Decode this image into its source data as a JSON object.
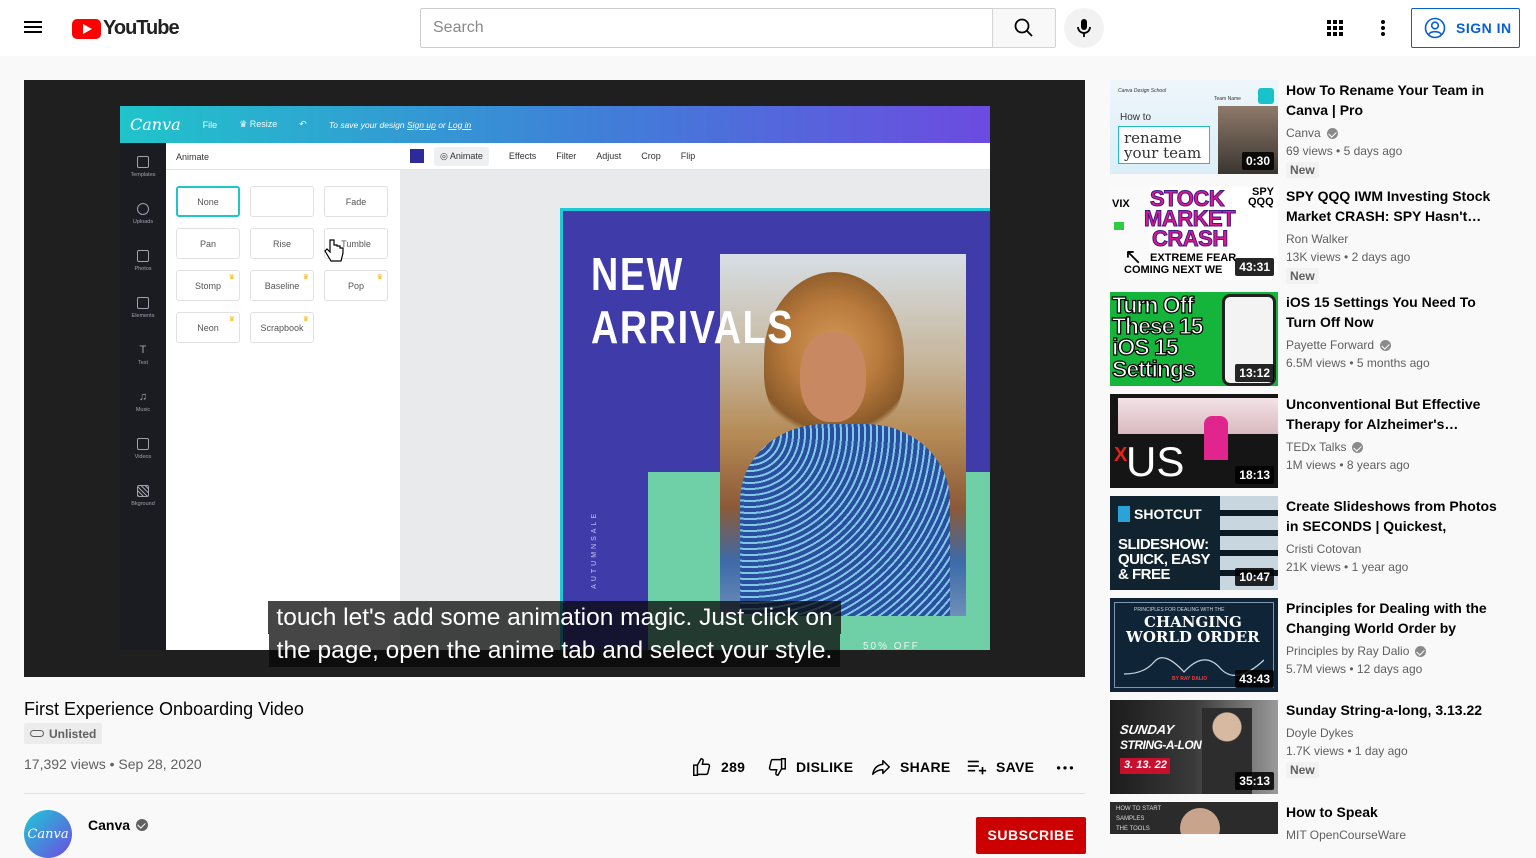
{
  "header": {
    "logo_text": "YouTube",
    "search_placeholder": "Search",
    "signin_label": "SIGN IN"
  },
  "player": {
    "canva_brand": "Canva",
    "canva_topbar": {
      "file": "File",
      "resize": "Resize",
      "note_prefix": "To save your design",
      "signup": "Sign up",
      "or": "or",
      "login": "Log in"
    },
    "left_tools": [
      "Templates",
      "Uploads",
      "Photos",
      "Elements",
      "Text",
      "Music",
      "Videos",
      "Bkground"
    ],
    "panel_title": "Animate",
    "animations": [
      "None",
      "",
      "Fade",
      "Pan",
      "Rise",
      "Tumble",
      "Stomp",
      "Baseline",
      "Pop",
      "Neon",
      "Scrapbook"
    ],
    "context_bar": [
      "Animate",
      "Effects",
      "Filter",
      "Adjust",
      "Crop",
      "Flip"
    ],
    "design_headline_1": "NEW",
    "design_headline_2": "ARRIVALS",
    "design_vertical_text": "AUTUMNSALE",
    "design_bottom_text": "50% OFF",
    "caption_line_1": "touch let's add some animation magic. Just click on",
    "caption_line_2": "the page, open the anime tab and select your style."
  },
  "video": {
    "title": "First Experience Onboarding Video",
    "visibility": "Unlisted",
    "views": "17,392 views",
    "date": "Sep 28, 2020",
    "likes": "289",
    "dislike_label": "DISLIKE",
    "share_label": "SHARE",
    "save_label": "SAVE"
  },
  "channel": {
    "name": "Canva",
    "avatar_text": "Canva",
    "subscribe_label": "SUBSCRIBE"
  },
  "recommendations": [
    {
      "title": "How To Rename Your Team in Canva | Pro",
      "channel": "Canva",
      "verified": true,
      "views": "69 views",
      "age": "5 days ago",
      "badge": "New",
      "duration": "0:30",
      "thumb_lines": [
        "Canva Design School",
        "How to",
        "rename",
        "your team",
        "Team Name"
      ]
    },
    {
      "title": "SPY QQQ IWM Investing Stock Market CRASH: SPY Hasn't…",
      "channel": "Ron Walker",
      "verified": false,
      "views": "13K views",
      "age": "2 days ago",
      "badge": "New",
      "duration": "43:31",
      "thumb_lines": [
        "VIX",
        "STOCK",
        "MARKET",
        "CRASH",
        "SPY",
        "QQQ",
        "EXTREME FEAR",
        "COMING NEXT WE"
      ]
    },
    {
      "title": "iOS 15 Settings You Need To Turn Off Now",
      "channel": "Payette Forward",
      "verified": true,
      "views": "6.5M views",
      "age": "5 months ago",
      "badge": "",
      "duration": "13:12",
      "thumb_lines": [
        "Turn Off",
        "These 15",
        "iOS 15",
        "Settings"
      ]
    },
    {
      "title": "Unconventional But Effective Therapy for Alzheimer's…",
      "channel": "TEDx Talks",
      "verified": true,
      "views": "1M views",
      "age": "8 years ago",
      "badge": "",
      "duration": "18:13",
      "thumb_lines": [
        "X",
        "US"
      ]
    },
    {
      "title": "Create Slideshows from Photos in SECONDS | Quickest, Easies…",
      "channel": "Cristi Cotovan",
      "verified": false,
      "views": "21K views",
      "age": "1 year ago",
      "badge": "",
      "duration": "10:47",
      "thumb_lines": [
        "SHOTCUT",
        "SLIDESHOW:",
        "QUICK, EASY",
        "& FREE"
      ]
    },
    {
      "title": "Principles for Dealing with the Changing World Order by Ray…",
      "channel": "Principles by Ray Dalio",
      "verified": true,
      "views": "5.7M views",
      "age": "12 days ago",
      "badge": "",
      "duration": "43:43",
      "thumb_lines": [
        "PRINCIPLES FOR DEALING WITH THE",
        "CHANGING",
        "WORLD ORDER",
        "BY RAY DALIO"
      ]
    },
    {
      "title": "Sunday String-a-long, 3.13.22",
      "channel": "Doyle Dykes",
      "verified": false,
      "views": "1.7K views",
      "age": "1 day ago",
      "badge": "New",
      "duration": "35:13",
      "thumb_lines": [
        "SUNDAY",
        "STRING-A-LONG",
        "3. 13. 22"
      ]
    },
    {
      "title": "How to Speak",
      "channel": "MIT OpenCourseWare",
      "verified": false,
      "views": "",
      "age": "",
      "badge": "",
      "duration": "",
      "thumb_lines": [
        "HOW TO START",
        "SAMPLES",
        "THE TOOLS"
      ]
    }
  ],
  "colors": {
    "brand_red": "#ff0000",
    "link_blue": "#065fd4",
    "subscribe_red": "#cc0000",
    "canva_teal": "#20c4cb",
    "canva_purple": "#6c4be0"
  },
  "icons": [
    "menu-icon",
    "search-icon",
    "mic-icon",
    "apps-icon",
    "more-vert-icon",
    "account-icon",
    "like-icon",
    "dislike-icon",
    "share-icon",
    "save-icon",
    "more-horiz-icon",
    "verified-icon"
  ]
}
